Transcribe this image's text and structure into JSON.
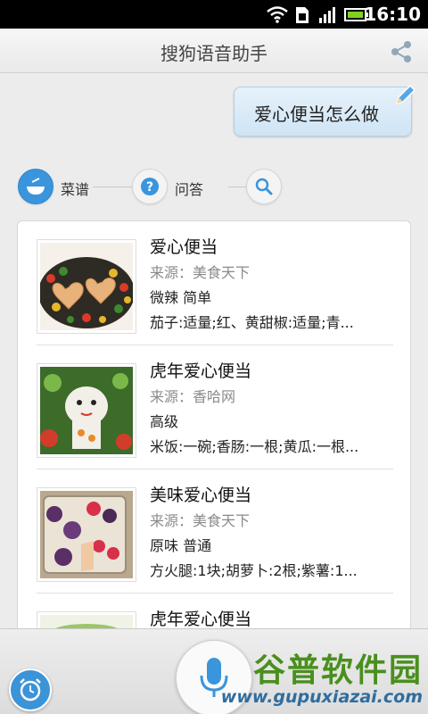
{
  "status_bar": {
    "time": "16:10"
  },
  "header": {
    "title": "搜狗语音助手"
  },
  "user_query": {
    "text": "爱心便当怎么做"
  },
  "tabs": [
    {
      "label": "菜谱",
      "active": true
    },
    {
      "label": "问答",
      "active": false
    },
    {
      "label": "",
      "active": false
    }
  ],
  "recipes": [
    {
      "title": "爱心便当",
      "source": "来源：美食天下",
      "tags": "微辣 简单",
      "ingredients": "茄子:适量;红、黄甜椒:适量;青..."
    },
    {
      "title": "虎年爱心便当",
      "source": "来源：香哈网",
      "tags": "高级",
      "ingredients": "米饭:一碗;香肠:一根;黄瓜:一根..."
    },
    {
      "title": "美味爱心便当",
      "source": "来源：美食天下",
      "tags": "原味 普通",
      "ingredients": "方火腿:1块;胡萝卜:2根;紫薯:1..."
    },
    {
      "title": "虎年爱心便当",
      "source": "",
      "tags": "",
      "ingredients": ""
    }
  ],
  "watermark": {
    "brand": "谷普软件园",
    "url": "www.gupuxiazai.com"
  },
  "colors": {
    "accent": "#3a95dc",
    "brand_green": "#4a8f1e"
  }
}
